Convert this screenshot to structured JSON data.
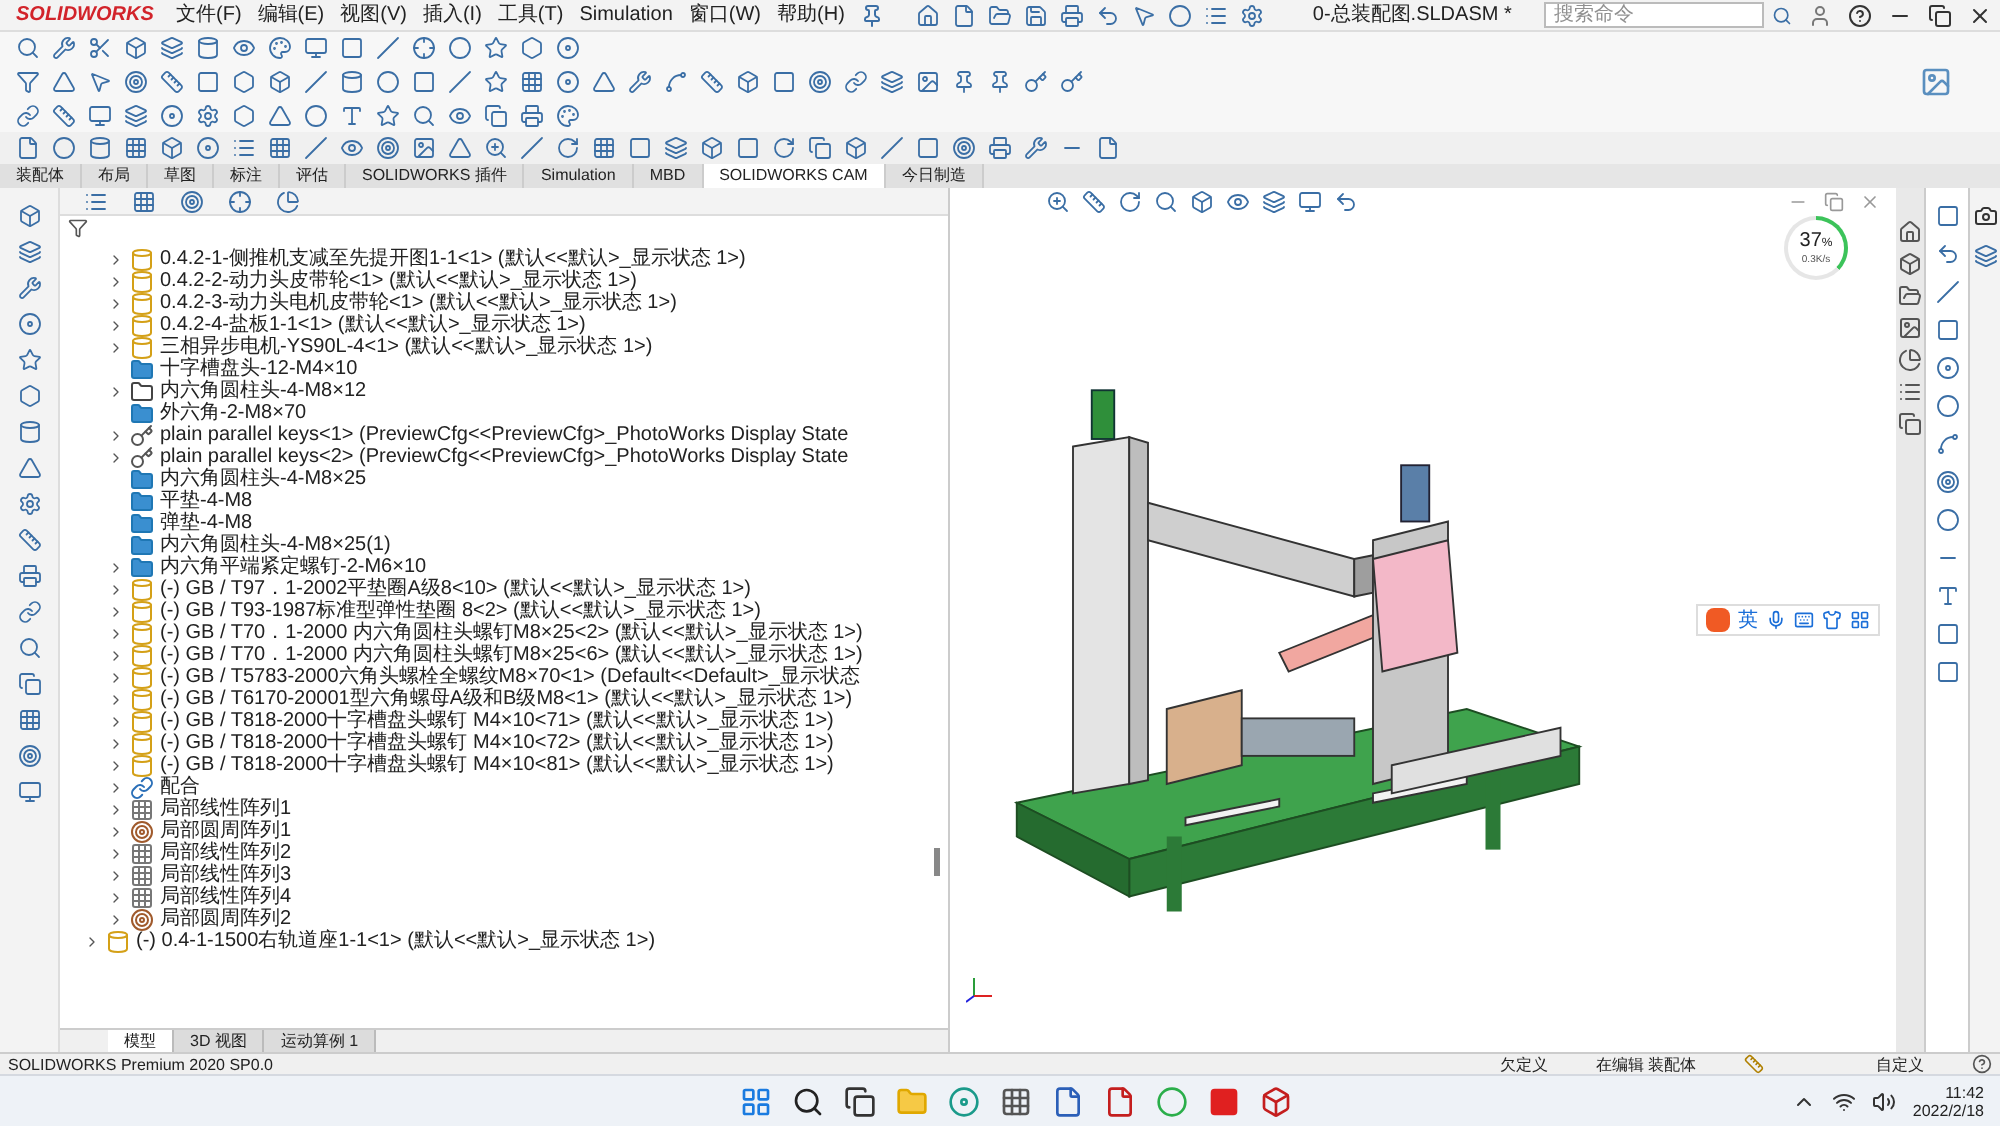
{
  "window": {
    "brand": "SOLIDWORKS",
    "title": "0-总装配图.SLDASM *"
  },
  "menu": [
    "文件(F)",
    "编辑(E)",
    "视图(V)",
    "插入(I)",
    "工具(T)",
    "Simulation",
    "窗口(W)",
    "帮助(H)"
  ],
  "search": {
    "placeholder": "搜索命令"
  },
  "tabs": [
    {
      "label": "装配体",
      "selected": false
    },
    {
      "label": "布局",
      "selected": false
    },
    {
      "label": "草图",
      "selected": false
    },
    {
      "label": "标注",
      "selected": false
    },
    {
      "label": "评估",
      "selected": false
    },
    {
      "label": "SOLIDWORKS 插件",
      "selected": false
    },
    {
      "label": "Simulation",
      "selected": false
    },
    {
      "label": "MBD",
      "selected": false
    },
    {
      "label": "SOLIDWORKS CAM",
      "selected": true
    },
    {
      "label": "今日制造",
      "selected": false
    }
  ],
  "tree": {
    "items": [
      {
        "children": [
          {
            "kind": "part",
            "label": "0.4.2-1-侧推机支减至先提开图1-1<1> (默认<<默认>_显示状态 1>)",
            "expanded": false
          },
          {
            "kind": "part",
            "label": "0.4.2-2-动力头皮带轮<1> (默认<<默认>_显示状态 1>)",
            "expanded": false
          },
          {
            "kind": "part",
            "label": "0.4.2-3-动力头电机皮带轮<1> (默认<<默认>_显示状态 1>)",
            "expanded": false
          },
          {
            "kind": "part",
            "label": "0.4.2-4-盐板1-1<1> (默认<<默认>_显示状态 1>)",
            "expanded": false
          },
          {
            "kind": "part",
            "label": "三相异步电机-YS90L-4<1> (默认<<默认>_显示状态 1>)",
            "expanded": false
          },
          {
            "kind": "folder",
            "label": "十字槽盘头-12-M4×10"
          },
          {
            "kind": "folder-empty",
            "label": "内六角圆柱头-4-M8×12",
            "expanded": false
          },
          {
            "kind": "folder",
            "label": "外六角-2-M8×70"
          },
          {
            "kind": "key",
            "label": "plain parallel keys<1> (PreviewCfg<<PreviewCfg>_PhotoWorks Display State",
            "expanded": false
          },
          {
            "kind": "key",
            "label": "plain parallel keys<2> (PreviewCfg<<PreviewCfg>_PhotoWorks Display State",
            "expanded": false
          },
          {
            "kind": "folder",
            "label": "内六角圆柱头-4-M8×25"
          },
          {
            "kind": "folder",
            "label": "平垫-4-M8"
          },
          {
            "kind": "folder",
            "label": "弹垫-4-M8"
          },
          {
            "kind": "folder",
            "label": "内六角圆柱头-4-M8×25(1)"
          },
          {
            "kind": "folder",
            "label": "内六角平端紧定螺钉-2-M6×10",
            "expanded": false
          },
          {
            "kind": "part",
            "label": "(-) GB / T97．1-2002平垫圈A级8<10> (默认<<默认>_显示状态 1>)",
            "expanded": false
          },
          {
            "kind": "part",
            "label": "(-) GB / T93-1987标准型弹性垫圈 8<2> (默认<<默认>_显示状态 1>)",
            "expanded": false
          },
          {
            "kind": "part",
            "label": "(-) GB / T70．1-2000 内六角圆柱头螺钉M8×25<2> (默认<<默认>_显示状态 1>)",
            "expanded": false
          },
          {
            "kind": "part",
            "label": "(-) GB / T70．1-2000 内六角圆柱头螺钉M8×25<6> (默认<<默认>_显示状态 1>)",
            "expanded": false
          },
          {
            "kind": "part",
            "label": "(-) GB / T5783-2000六角头螺栓全螺纹M8×70<1> (Default<<Default>_显示状态",
            "expanded": false
          },
          {
            "kind": "part",
            "label": "(-) GB / T6170-20001型六角螺母A级和B级M8<1> (默认<<默认>_显示状态 1>)",
            "expanded": false
          },
          {
            "kind": "part",
            "label": "(-) GB / T818-2000十字槽盘头螺钉 M4×10<71> (默认<<默认>_显示状态 1>)",
            "expanded": false
          },
          {
            "kind": "part",
            "label": "(-) GB / T818-2000十字槽盘头螺钉 M4×10<72> (默认<<默认>_显示状态 1>)",
            "expanded": false
          },
          {
            "kind": "part",
            "label": "(-) GB / T818-2000十字槽盘头螺钉 M4×10<81> (默认<<默认>_显示状态 1>)",
            "expanded": false
          },
          {
            "kind": "mate",
            "label": "配合",
            "expanded": false
          },
          {
            "kind": "linear-pattern",
            "label": "局部线性阵列1",
            "expanded": false
          },
          {
            "kind": "circular-pattern",
            "label": "局部圆周阵列1",
            "expanded": false
          },
          {
            "kind": "linear-pattern",
            "label": "局部线性阵列2",
            "expanded": false
          },
          {
            "kind": "linear-pattern",
            "label": "局部线性阵列3",
            "expanded": false
          },
          {
            "kind": "linear-pattern",
            "label": "局部线性阵列4",
            "expanded": false
          },
          {
            "kind": "circular-pattern",
            "label": "局部圆周阵列2",
            "expanded": false
          }
        ]
      },
      {
        "kind": "part",
        "label": "(-) 0.4-1-1500右轨道座1-1<1> (默认<<默认>_显示状态 1>)",
        "expanded": false
      }
    ]
  },
  "bottom_tabs": [
    {
      "label": "模型",
      "selected": true
    },
    {
      "label": "3D 视图",
      "selected": false
    },
    {
      "label": "运动算例 1",
      "selected": false
    }
  ],
  "net_widget": {
    "percent": "37",
    "unit": "%",
    "speed": "0.3K/s"
  },
  "ime": {
    "label": "英"
  },
  "status_bar": {
    "product": "SOLIDWORKS Premium 2020 SP0.0",
    "items": [
      "欠定义",
      "在编辑 装配体"
    ],
    "units": "自定义"
  },
  "taskbar": {
    "time": "11:42",
    "date": "2022/2/18"
  }
}
